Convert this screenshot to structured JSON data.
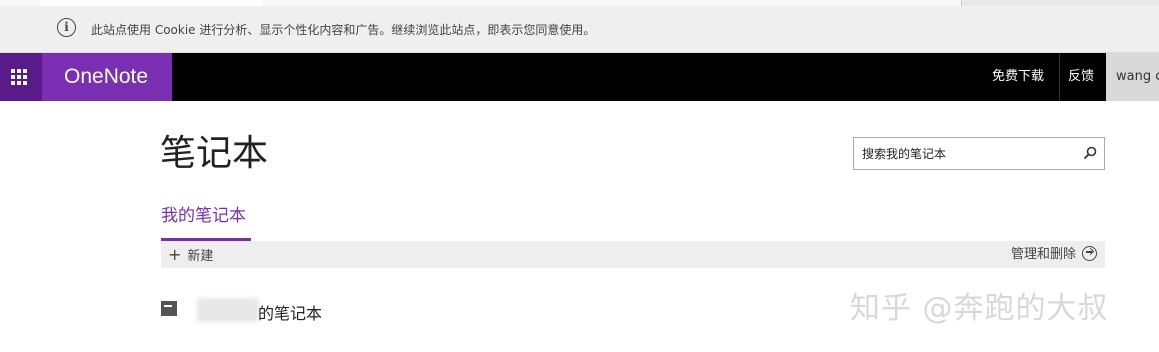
{
  "cookie_bar": {
    "icon": "info-icon",
    "message": "此站点使用 Cookie 进行分析、显示个性化内容和广告。继续浏览此站点，即表示您同意使用。"
  },
  "suite_header": {
    "app_name": "OneNote",
    "app_launcher_icon": "waffle-icon",
    "download_label": "免费下载",
    "feedback_label": "反馈",
    "user_name": "wang c",
    "colors": {
      "bar": "#000000",
      "brand": "#7a2fb3",
      "launcher": "#5a1b8a"
    }
  },
  "main": {
    "title": "笔记本",
    "search": {
      "placeholder": "搜索我的笔记本",
      "icon": "search-icon"
    },
    "tab_mine": "我的笔记本",
    "commands": {
      "new_label": "新建",
      "new_icon": "plus-icon",
      "manage_label": "管理和删除",
      "manage_icon": "arrow-right-circle-icon"
    },
    "notebooks": [
      {
        "name_suffix": "的笔记本",
        "icon": "notebook-icon"
      }
    ]
  },
  "watermark": "知乎 @奔跑的大叔"
}
